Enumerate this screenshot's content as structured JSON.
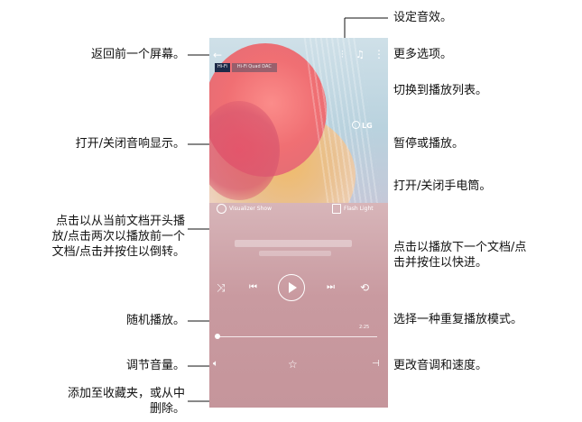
{
  "player": {
    "hifi_badge": "Hi-Fi",
    "hifi_sub": "Hi-Fi Quad DAC",
    "brand": "LG",
    "visualizer_label": "Visualizer Show",
    "flashlight_label": "Flash Light",
    "elapsed": "2:25"
  },
  "callouts": {
    "back": "返回前一个屏幕。",
    "sound_effects": "设定音效。",
    "more_options": "更多选项。",
    "switch_playlist": "切换到播放列表。",
    "visualizer_toggle": "打开/关闭音响显示。",
    "pause_play": "暂停或播放。",
    "flashlight_toggle": "打开/关闭手电筒。",
    "prev_line1": "点击以从当前文档开头播",
    "prev_line2": "放/点击两次以播放前一个",
    "prev_line3": "文档/点击并按住以倒转。",
    "next_line1": "点击以播放下一个文档/点",
    "next_line2": "击并按住以快进。",
    "shuffle": "随机播放。",
    "repeat": "选择一种重复播放模式。",
    "volume": "调节音量。",
    "pitch_speed": "更改音调和速度。",
    "favorite_line1": "添加至收藏夹，或从中",
    "favorite_line2": "删除。"
  }
}
